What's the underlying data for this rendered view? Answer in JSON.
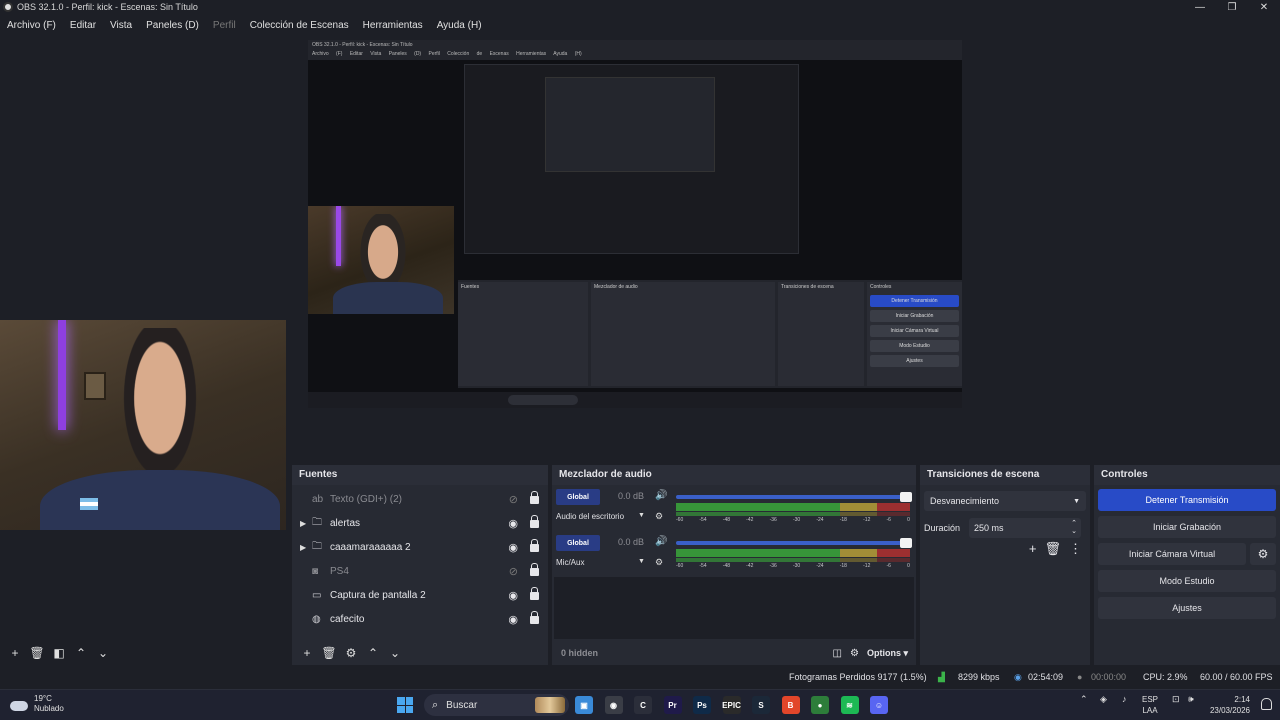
{
  "window": {
    "title": "OBS 32.1.0 - Perfil: kick - Escenas: Sin Título",
    "minimize": "—",
    "maximize": "❐",
    "close": "✕"
  },
  "menu": {
    "items": [
      {
        "label": "Archivo (F)",
        "disabled": false
      },
      {
        "label": "Editar",
        "disabled": false
      },
      {
        "label": "Vista",
        "disabled": false
      },
      {
        "label": "Paneles (D)",
        "disabled": false
      },
      {
        "label": "Perfil",
        "disabled": true
      },
      {
        "label": "Colección de Escenas",
        "disabled": false
      },
      {
        "label": "Herramientas",
        "disabled": false
      },
      {
        "label": "Ayuda (H)",
        "disabled": false
      }
    ]
  },
  "preview": {
    "nested_title": "OBS 32.1.0 - Perfil: kick - Escenas: Sin Título",
    "nested_menu": "Archivo (F) Editar Vista Paneles (D) Perfil Colección de Escenas Herramientas Ayuda (H)",
    "nested_panels": {
      "sources": "Fuentes",
      "mixer": "Mezclador de audio",
      "transitions": "Transiciones de escena",
      "controls": "Controles",
      "stop": "Detener Transmisión",
      "rec": "Iniciar Grabación",
      "vcam": "Iniciar Cámara Virtual",
      "studio": "Modo Estudio",
      "settings": "Ajustes"
    }
  },
  "sources": {
    "title": "Fuentes",
    "items": [
      {
        "label": "Texto (GDI+) (2)",
        "icon": "text-icon",
        "glyph": "ab",
        "expandable": false,
        "visible": false
      },
      {
        "label": "alertas",
        "icon": "folder-icon",
        "glyph": "🗀",
        "expandable": true,
        "visible": true
      },
      {
        "label": "caaamaraaaaaa 2",
        "icon": "folder-icon",
        "glyph": "🗀",
        "expandable": true,
        "visible": true
      },
      {
        "label": "PS4",
        "icon": "camera-icon",
        "glyph": "◙",
        "expandable": false,
        "visible": false
      },
      {
        "label": "Captura de pantalla 2",
        "icon": "monitor-icon",
        "glyph": "▭",
        "expandable": false,
        "visible": true
      },
      {
        "label": "cafecito",
        "icon": "globe-icon",
        "glyph": "◍",
        "expandable": false,
        "visible": true
      }
    ]
  },
  "mixer": {
    "title": "Mezclador de audio",
    "channels": [
      {
        "badge": "Global",
        "db": "0.0 dB",
        "name": "Audio del escritorio",
        "volume": 1.0,
        "ticks": [
          "-60",
          "-54",
          "-48",
          "-42",
          "-36",
          "-30",
          "-24",
          "-18",
          "-12",
          "-6",
          "0"
        ]
      },
      {
        "badge": "Global",
        "db": "0.0 dB",
        "name": "Mic/Aux",
        "volume": 1.0,
        "ticks": [
          "-60",
          "-54",
          "-48",
          "-42",
          "-36",
          "-30",
          "-24",
          "-18",
          "-12",
          "-6",
          "0"
        ]
      }
    ],
    "hidden_label": "0 hidden",
    "options_label": "Options"
  },
  "transitions": {
    "title": "Transiciones de escena",
    "selected": "Desvanecimiento",
    "duration_label": "Duración",
    "duration_value": "250 ms"
  },
  "controls": {
    "title": "Controles",
    "stop_stream": "Detener Transmisión",
    "start_recording": "Iniciar Grabación",
    "start_virtual_cam": "Iniciar Cámara Virtual",
    "studio_mode": "Modo Estudio",
    "settings": "Ajustes"
  },
  "status": {
    "dropped_frames": "Fotogramas Perdidos 9177 (1.5%)",
    "bitrate": "8299 kbps",
    "stream_time": "02:54:09",
    "rec_time": "00:00:00",
    "cpu": "CPU: 2.9%",
    "fps": "60.00 / 60.00 FPS"
  },
  "taskbar": {
    "temp": "19°C",
    "condition": "Nublado",
    "search_placeholder": "Buscar",
    "lang_top": "ESP",
    "lang_bottom": "LAA",
    "time": "2:14",
    "date": "23/03/2026",
    "apps": [
      {
        "name": "files-app-icon",
        "glyph": "▣",
        "color": "#3a8ad8"
      },
      {
        "name": "obs-app-icon",
        "glyph": "◉",
        "color": "#3a3d46"
      },
      {
        "name": "capcut-app-icon",
        "glyph": "C",
        "color": "#2b2e3a"
      },
      {
        "name": "premiere-app-icon",
        "glyph": "Pr",
        "color": "#1f1a4a"
      },
      {
        "name": "photoshop-app-icon",
        "glyph": "Ps",
        "color": "#0f2a48"
      },
      {
        "name": "epic-app-icon",
        "glyph": "EPIC",
        "color": "#2a2a2a"
      },
      {
        "name": "steam-app-icon",
        "glyph": "S",
        "color": "#1b2838"
      },
      {
        "name": "brave-app-icon",
        "glyph": "B",
        "color": "#e2462a"
      },
      {
        "name": "chrome-app-icon",
        "glyph": "●",
        "color": "#2d7d3a"
      },
      {
        "name": "spotify-app-icon",
        "glyph": "≋",
        "color": "#1db954"
      },
      {
        "name": "discord-app-icon",
        "glyph": "☺",
        "color": "#5865f2"
      }
    ]
  }
}
